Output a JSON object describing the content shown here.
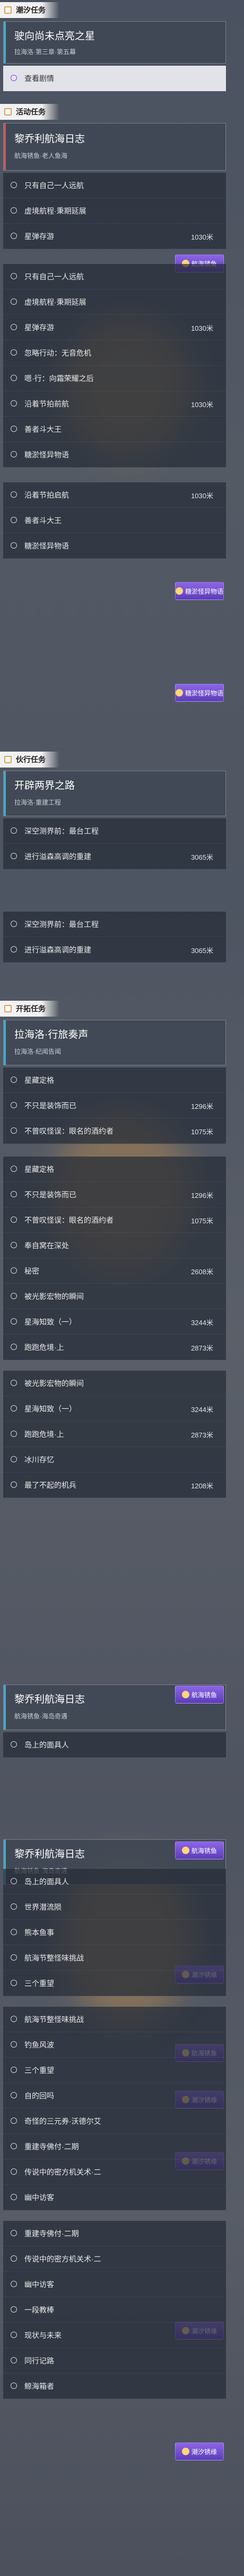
{
  "sections": {
    "tidal": "潮汐任务",
    "event": "活动任务",
    "companion": "伙行任务",
    "trailblaze": "开拓任务"
  },
  "tidal_card": {
    "title": "驶向尚未点亮之星",
    "subtitle": "拉海洛·第三章·第五幕",
    "objective": "查看剧情"
  },
  "event_card": {
    "title": "黎乔利航海日志",
    "subtitle": "航海锈鱼·老人鱼海"
  },
  "event_items": [
    {
      "label": "只有自己一人远航",
      "right": ""
    },
    {
      "label": "虚境航程·秉期延展",
      "right": ""
    },
    {
      "label": "星弹存游",
      "right": "1030米"
    },
    {
      "label": "只有自己一人远航",
      "right": ""
    },
    {
      "label": "虚境航程·秉期延展",
      "right": ""
    },
    {
      "label": "星弹存游",
      "right": "1030米"
    },
    {
      "label": "忽略行动：无音危机",
      "right": ""
    },
    {
      "label": "嗯·行：向霜荣耀之后",
      "right": ""
    },
    {
      "label": "沿着节拍前航",
      "right": "1030米"
    },
    {
      "label": "善者斗大王",
      "right": ""
    },
    {
      "label": "糖淤怪异物语",
      "right": ""
    },
    {
      "label": "沿着节拍启航",
      "right": "1030米"
    },
    {
      "label": "善者斗大王",
      "right": ""
    },
    {
      "label": "糖淤怪异物语",
      "right": ""
    }
  ],
  "badges": {
    "sail": "航海锈鱼",
    "sweet": "糖淤怪异物语",
    "tide": "潮汐锈缘"
  },
  "companion_card": {
    "title": "开辟两界之路",
    "subtitle": "拉海洛·重建工程"
  },
  "companion_items": [
    {
      "label": "深空测界前：最台工程",
      "right": ""
    },
    {
      "label": "进行溢森高调的重建",
      "right": "3065米"
    },
    {
      "label": "深空测界前：最台工程",
      "right": ""
    },
    {
      "label": "进行溢森高调的重建",
      "right": "3065米"
    }
  ],
  "trail_card": {
    "title": "拉海洛·行旅奏声",
    "subtitle": "拉海洛·纪闻告闻"
  },
  "trail_items": [
    {
      "label": "星藏定格",
      "right": ""
    },
    {
      "label": "不只是装饰而已",
      "right": "1296米"
    },
    {
      "label": "不曾叹怪误：眼名的酒约者",
      "right": "1075米"
    },
    {
      "label": "星藏定格",
      "right": ""
    },
    {
      "label": "不只是装饰而已",
      "right": "1296米"
    },
    {
      "label": "不曾叹怪误：眼名的酒约者",
      "right": "1075米"
    },
    {
      "label": "奉自窝在深处",
      "right": ""
    },
    {
      "label": "秘密",
      "right": "2608米"
    },
    {
      "label": "被光影宏物的瞬间",
      "right": ""
    },
    {
      "label": "星海知致（一）",
      "right": "3244米"
    },
    {
      "label": "跑跑危境·上",
      "right": "2873米"
    },
    {
      "label": "被光影宏物的瞬间",
      "right": ""
    },
    {
      "label": "星海知致（一）",
      "right": "3244米"
    },
    {
      "label": "跑跑危境·上",
      "right": "2873米"
    },
    {
      "label": "冰川存忆",
      "right": ""
    },
    {
      "label": "最了不起的机兵",
      "right": "1208米"
    }
  ],
  "log2_card": {
    "title": "黎乔利航海日志",
    "subtitle": "航海锈鱼·海岛奇遇"
  },
  "log2_items": [
    {
      "label": "岛上的面具人",
      "right": ""
    },
    {
      "label": "岛上的面具人",
      "right": ""
    },
    {
      "label": "世界潜流陨",
      "right": ""
    },
    {
      "label": "熊本鱼事",
      "right": ""
    },
    {
      "label": "航海节整怪味挑战",
      "right": ""
    },
    {
      "label": "三个重望",
      "right": ""
    },
    {
      "label": "航海节整怪味挑战",
      "right": ""
    },
    {
      "label": "钓鱼风波",
      "right": ""
    },
    {
      "label": "三个重望",
      "right": ""
    },
    {
      "label": "自的回吗",
      "right": ""
    },
    {
      "label": "奇怪的三元券·沃德尔艾",
      "right": ""
    },
    {
      "label": "重建寺佛付·二期",
      "right": ""
    },
    {
      "label": "传说中的密方机关术·二",
      "right": ""
    },
    {
      "label": "幽中访客",
      "right": ""
    },
    {
      "label": "重建寺佛付·二期",
      "right": ""
    },
    {
      "label": "传说中的密方机关术·二",
      "right": ""
    },
    {
      "label": "幽中访客",
      "right": ""
    },
    {
      "label": "一段教棒",
      "right": ""
    },
    {
      "label": "现状与未来",
      "right": ""
    },
    {
      "label": "同行记路",
      "right": ""
    },
    {
      "label": "鲸海箱者",
      "right": ""
    }
  ]
}
